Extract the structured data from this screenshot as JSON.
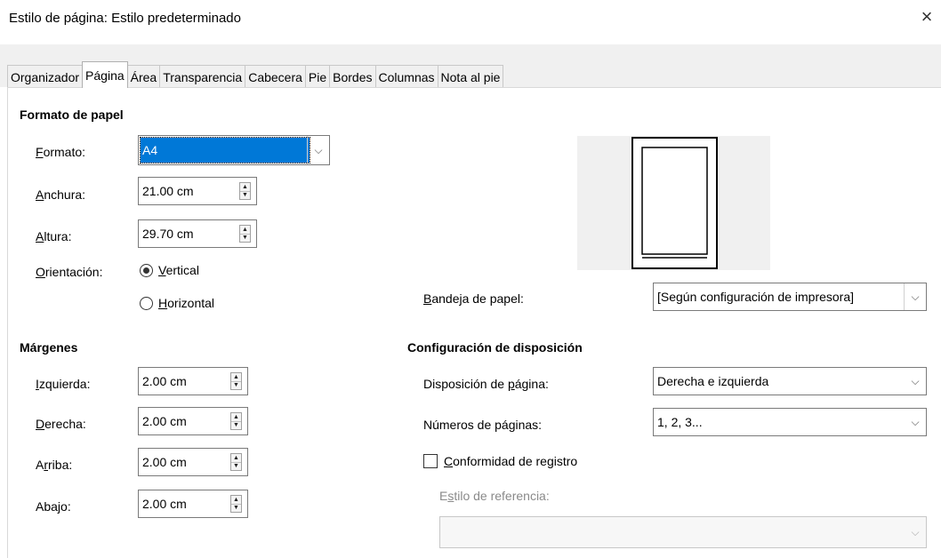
{
  "window": {
    "title": "Estilo de página: Estilo predeterminado",
    "close": "×"
  },
  "tabs": [
    {
      "label": "Organizador"
    },
    {
      "label": "Página"
    },
    {
      "label": "Área"
    },
    {
      "label": "Transparencia"
    },
    {
      "label": "Cabecera"
    },
    {
      "label": "Pie"
    },
    {
      "label": "Bordes"
    },
    {
      "label": "Columnas"
    },
    {
      "label": "Nota al pie"
    }
  ],
  "paper": {
    "heading": "Formato de papel",
    "format_label_u": "F",
    "format_label_rest": "ormato:",
    "format_value": "A4",
    "width_label_u": "A",
    "width_label_rest": "nchura:",
    "width_value": "21.00 cm",
    "height_label_u": "A",
    "height_label_rest": "ltura:",
    "height_value": "29.70 cm",
    "orientation_label_u": "O",
    "orientation_label_rest": "rientación:",
    "vertical_u": "V",
    "vertical_rest": "ertical",
    "horizontal_u": "H",
    "horizontal_rest": "orizontal",
    "tray_label_u": "B",
    "tray_label_rest": "andeja de papel:",
    "tray_value": "[Según configuración de impresora]"
  },
  "margins": {
    "heading": "Márgenes",
    "left_label_u": "I",
    "left_label_rest": "zquierda:",
    "left_value": "2.00 cm",
    "right_label_u": "D",
    "right_label_rest": "erecha:",
    "right_value": "2.00 cm",
    "top_label_pre": "A",
    "top_label_u": "r",
    "top_label_rest": "riba:",
    "top_value": "2.00 cm",
    "bottom_label_pre": "Aba",
    "bottom_label_u": "j",
    "bottom_label_rest": "o:",
    "bottom_value": "2.00 cm"
  },
  "layout": {
    "heading": "Configuración de disposición",
    "page_layout_pre": "Disposición de ",
    "page_layout_u": "p",
    "page_layout_rest": "ágina:",
    "page_layout_value": "Derecha e izquierda",
    "page_numbers_label": "Números de páginas:",
    "page_numbers_value": "1, 2, 3...",
    "register_u": "C",
    "register_rest": "onformidad de registro",
    "ref_style_pre": "E",
    "ref_style_u": "s",
    "ref_style_rest": "tilo de referencia:",
    "ref_style_value": ""
  },
  "icons": {
    "chevron": "⌵",
    "spin_up": "▲",
    "spin_down": "▼"
  },
  "colors": {
    "selection": "#0078d7",
    "tab_bg": "#f0f0f0",
    "preview_bg": "#f0f0f0"
  }
}
